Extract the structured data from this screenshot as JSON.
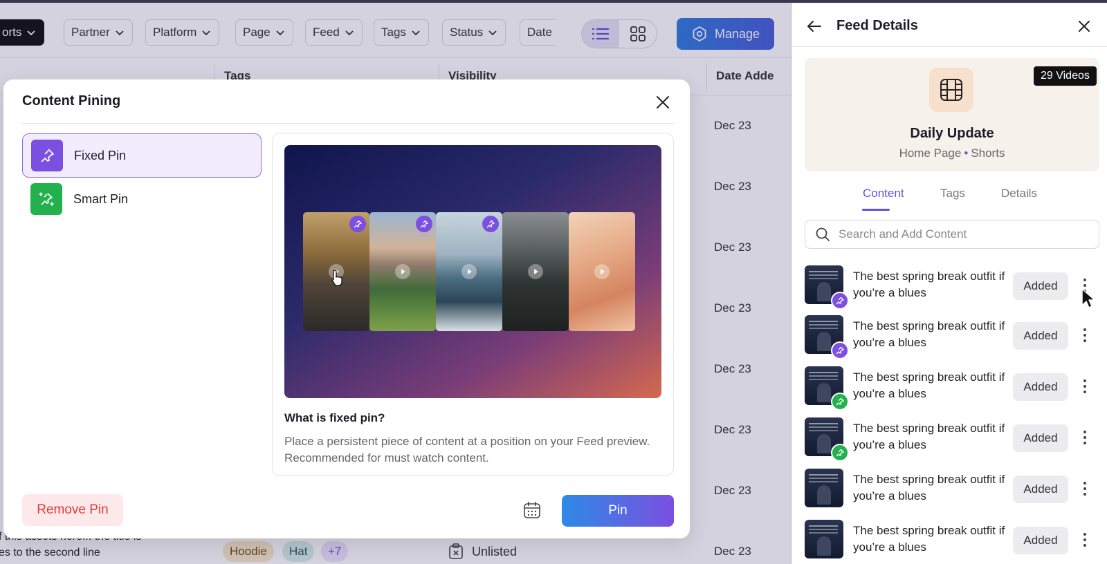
{
  "filters": {
    "sorts_label": "orts",
    "items": [
      "Partner",
      "Platform",
      "Page",
      "Feed",
      "Tags",
      "Status",
      "Date"
    ],
    "manage_label": "Manage"
  },
  "table": {
    "columns": [
      "Tags",
      "Visibility",
      "Date Adde"
    ],
    "dates": [
      "Dec 23",
      "Dec 23",
      "Dec 23",
      "Dec 23",
      "Dec 23",
      "Dec 23",
      "Dec 23",
      "Dec 23"
    ],
    "partial_title_line1": "f this assets here... the title is",
    "partial_title_line2": "es to the second line",
    "tag_pills": [
      "Hoodie",
      "Hat",
      "+7"
    ],
    "visibility_value": "Unlisted"
  },
  "modal": {
    "title": "Content Pining",
    "options": [
      {
        "label": "Fixed Pin",
        "selected": true,
        "icon": "pin-icon",
        "color": "#7b4fe0"
      },
      {
        "label": "Smart Pin",
        "selected": false,
        "icon": "sparkle-pin-icon",
        "color": "#22b14c"
      }
    ],
    "what_title": "What is fixed pin?",
    "what_desc": "Place a persistent piece of content at a position on your Feed preview. Recommended for must watch content.",
    "remove_label": "Remove Pin",
    "pin_label": "Pin"
  },
  "panel": {
    "title": "Feed Details",
    "videos_badge": "29 Videos",
    "feed_name": "Daily Update",
    "feed_page": "Home Page",
    "feed_type": "Shorts",
    "tabs": [
      "Content",
      "Tags",
      "Details"
    ],
    "active_tab": "Content",
    "search_placeholder": "Search and Add Content",
    "items": [
      {
        "title": "The best spring break outfit if you’re a blues",
        "status": "Added",
        "pin": "fixed"
      },
      {
        "title": "The best spring break outfit if you’re a blues",
        "status": "Added",
        "pin": "fixed"
      },
      {
        "title": "The best spring break outfit if you’re a blues",
        "status": "Added",
        "pin": "smart"
      },
      {
        "title": "The best spring break outfit if you’re a blues",
        "status": "Added",
        "pin": "smart"
      },
      {
        "title": "The best spring break outfit if you’re a blues",
        "status": "Added",
        "pin": "none"
      },
      {
        "title": "The best spring break outfit if you’re a blues",
        "status": "Added",
        "pin": "none"
      }
    ]
  },
  "colors": {
    "accent": "#7b4fe0",
    "smart": "#22b14c",
    "danger": "#e23a3a",
    "blue": "#2d8ae6"
  }
}
